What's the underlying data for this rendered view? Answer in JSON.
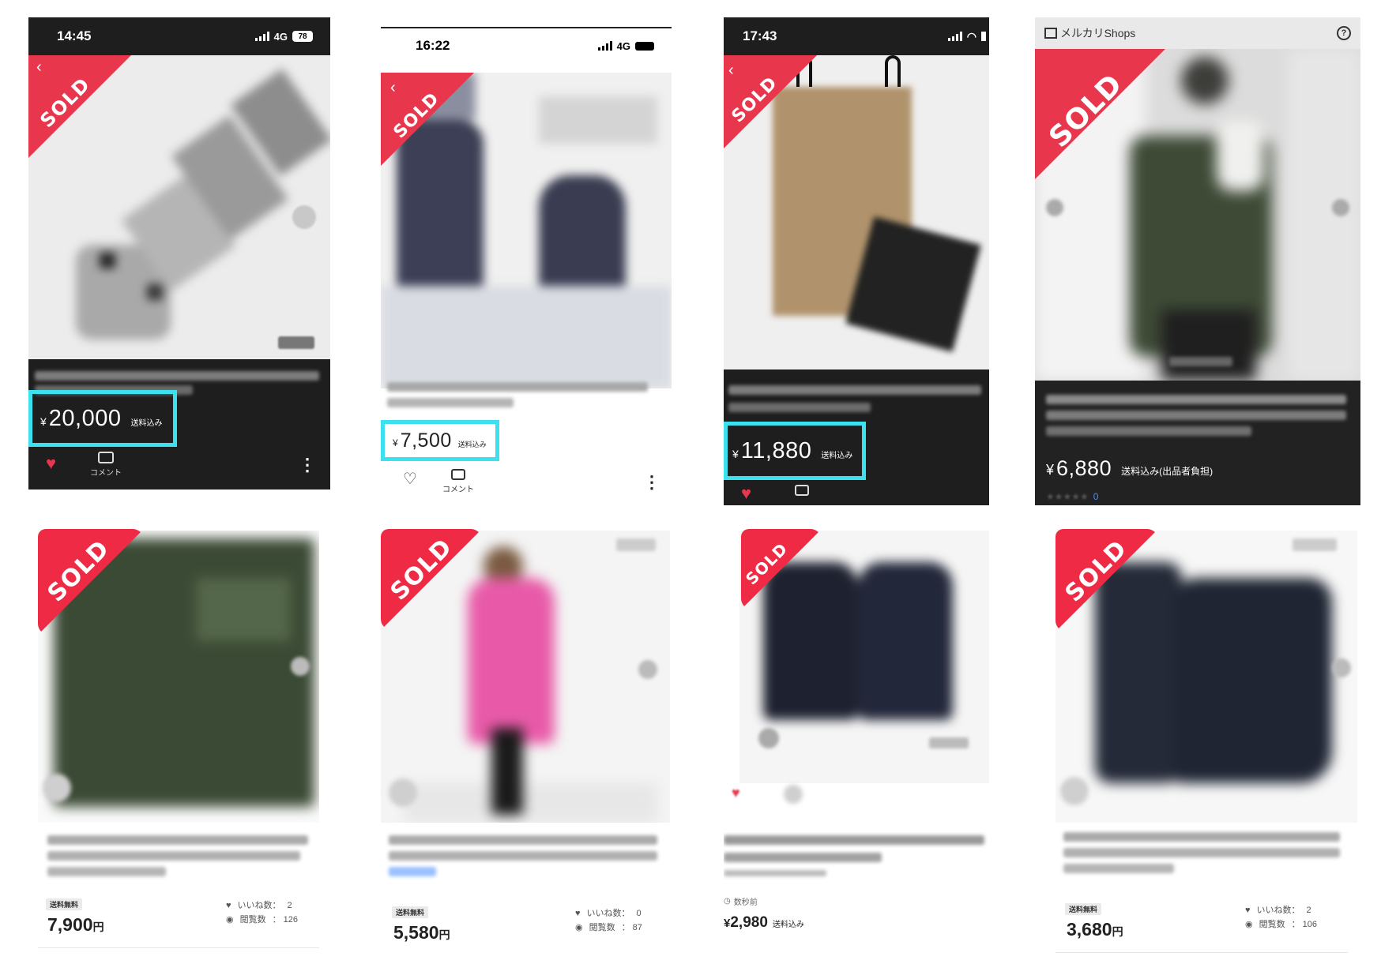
{
  "sold_label": "SOLD",
  "colors": {
    "sold_red": "#e8374d",
    "highlight_cyan": "#3ce0ee",
    "dark_panel": "#1e1e1e",
    "heart_red": "#e8374d"
  },
  "top": [
    {
      "time": "14:45",
      "network": "4G",
      "battery": "78",
      "yen": "¥",
      "price": "20,000",
      "shipping": "送料込み",
      "comment_label": "コメント"
    },
    {
      "time": "16:22",
      "network": "4G",
      "yen": "¥",
      "price": "7,500",
      "shipping": "送料込み",
      "comment_label": "コメント"
    },
    {
      "time": "17:43",
      "yen": "¥",
      "price": "11,880",
      "shipping": "送料込み"
    },
    {
      "shop_name": "メルカリShops",
      "help_icon": "question-circle-icon",
      "yen": "¥",
      "price": "6,880",
      "shipping": "送料込み(出品者負担)",
      "rating_count": "0"
    }
  ],
  "bottom": [
    {
      "free_shipping": "送料無料",
      "price": "7,900",
      "currency": "円",
      "likes_label": "いいね数：",
      "likes": "2",
      "views_label": "閲覧数",
      "views": "： 126"
    },
    {
      "free_shipping": "送料無料",
      "price": "5,580",
      "currency": "円",
      "likes_label": "いいね数：",
      "likes": "0",
      "views_label": "閲覧数",
      "views": "： 87"
    },
    {
      "posted": "数秒前",
      "yen": "¥",
      "price": "2,980",
      "shipping": "送料込み"
    },
    {
      "free_shipping": "送料無料",
      "price": "3,680",
      "currency": "円",
      "likes_label": "いいね数：",
      "likes": "2",
      "views_label": "閲覧数",
      "views": "： 106"
    }
  ]
}
